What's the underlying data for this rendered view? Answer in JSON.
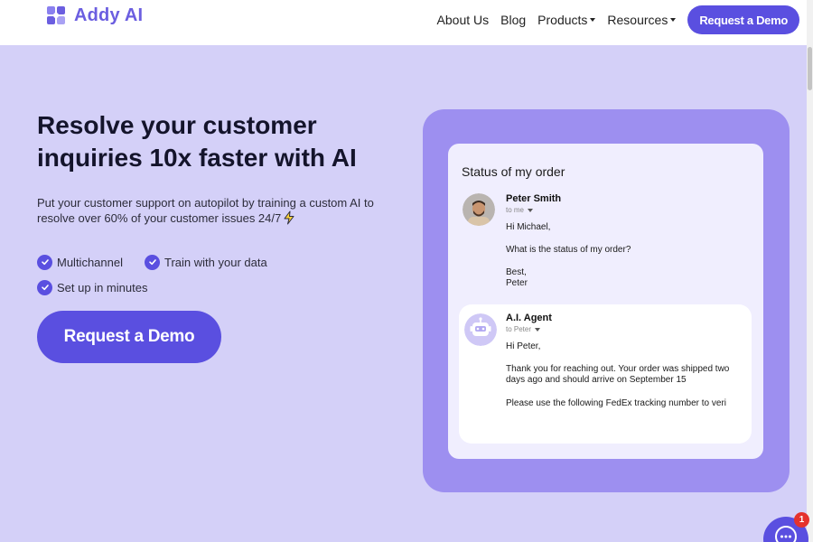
{
  "header": {
    "brand": "Addy AI",
    "nav": [
      {
        "label": "About Us",
        "dropdown": false
      },
      {
        "label": "Blog",
        "dropdown": false
      },
      {
        "label": "Products",
        "dropdown": true
      },
      {
        "label": "Resources",
        "dropdown": true
      }
    ],
    "cta_label": "Request a Demo"
  },
  "hero": {
    "headline": "Resolve your customer inquiries 10x faster with AI",
    "subtext": "Put your customer support on autopilot by training a custom AI to resolve over 60% of your customer issues 24/7",
    "features": [
      "Multichannel",
      "Train with your data",
      "Set up in minutes"
    ],
    "cta_label": "Request a Demo"
  },
  "email_demo": {
    "subject": "Status of my order",
    "incoming": {
      "sender": "Peter Smith",
      "to": "to me",
      "lines": [
        "Hi Michael,",
        "What is the status of my order?",
        "Best,",
        "Peter"
      ]
    },
    "reply": {
      "sender": "A.I. Agent",
      "to": "to Peter",
      "lines": [
        "Hi Peter,",
        "Thank you for reaching out. Your order was shipped two days ago and should arrive on September 15",
        "Please use the following FedEx tracking number to veri"
      ]
    }
  },
  "chat_widget": {
    "badge_count": "1"
  },
  "colors": {
    "brand": "#5a4fe0",
    "background": "#d4d0f8",
    "panel": "#9d8ff0"
  },
  "icons": [
    "logo-icon",
    "check-icon",
    "lightning-icon",
    "avatar-photo",
    "robot-icon",
    "chat-icon"
  ]
}
